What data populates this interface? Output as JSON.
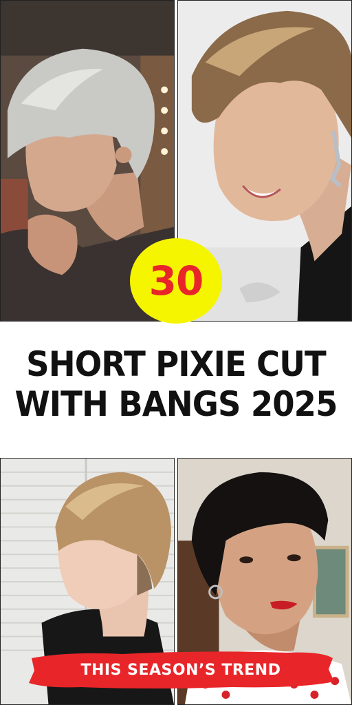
{
  "badge": {
    "number": "30"
  },
  "headline": {
    "line1": "SHORT PIXIE CUT",
    "line2": "WITH BANGS 2025"
  },
  "banner": {
    "label": "THIS SEASON’S TREND"
  },
  "colors": {
    "badge_fill": "#f6f500",
    "badge_text": "#e8262a",
    "banner_fill": "#e8262a",
    "headline_text": "#111111"
  }
}
